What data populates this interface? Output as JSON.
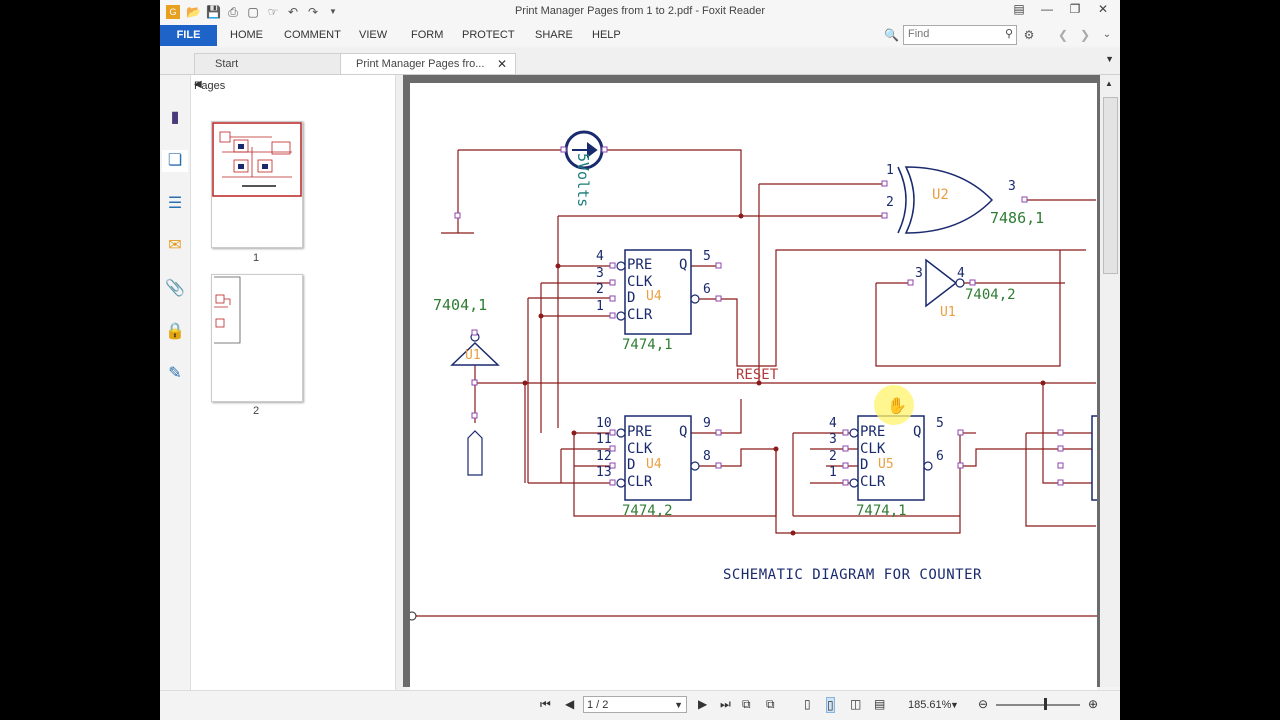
{
  "window": {
    "title": "Print Manager Pages from  1 to 2.pdf - Foxit Reader"
  },
  "menu": {
    "file": "FILE",
    "items": [
      "HOME",
      "COMMENT",
      "VIEW",
      "FORM",
      "PROTECT",
      "SHARE",
      "HELP"
    ]
  },
  "search": {
    "placeholder": "Find"
  },
  "tabs": [
    {
      "label": "Start"
    },
    {
      "label": "Print Manager Pages fro..."
    }
  ],
  "pages_panel": {
    "title": "Pages",
    "thumbnails": [
      {
        "label": "1"
      },
      {
        "label": "2"
      }
    ]
  },
  "schematic": {
    "source_label": "5Volts",
    "gates": {
      "u2": "U2",
      "u2_part": "7486,1",
      "u1_top": "U1",
      "u1_top_part": "7404,2",
      "u1_left": "U1",
      "u1_left_part": "7404,1"
    },
    "flipflops": [
      {
        "id": "U4",
        "part": "7474,1",
        "pins": [
          "PRE",
          "CLK",
          "D",
          "CLR"
        ],
        "q": "Q"
      },
      {
        "id": "U4",
        "part": "7474,2",
        "pins": [
          "PRE",
          "CLK",
          "D",
          "CLR"
        ],
        "q": "Q"
      },
      {
        "id": "U5",
        "part": "7474,1",
        "pins": [
          "PRE",
          "CLK",
          "D",
          "CLR"
        ],
        "q": "Q"
      }
    ],
    "reset_label": "RESET",
    "caption": "SCHEMATIC DIAGRAM FOR COUNTER",
    "pin_numbers": [
      "1",
      "2",
      "3",
      "4",
      "5",
      "6",
      "8",
      "9",
      "10",
      "11",
      "12",
      "13"
    ]
  },
  "status": {
    "page_value": "1 / 2",
    "zoom": "185.61%"
  },
  "colors": {
    "file_button": "#1e64c8",
    "wire": "#8b1a1a",
    "component": "#1a2a6e",
    "label_green": "#2e7d32",
    "ref_orange": "#e8a040",
    "pin": "#8e44ad"
  }
}
